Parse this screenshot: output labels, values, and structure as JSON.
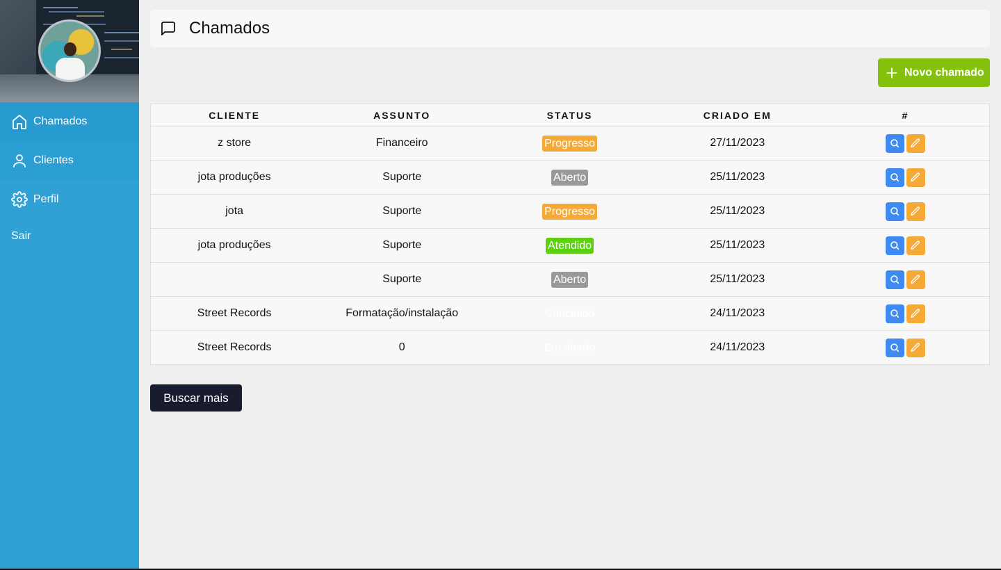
{
  "sidebar": {
    "items": [
      {
        "label": "Chamados",
        "icon": "home-icon"
      },
      {
        "label": "Clientes",
        "icon": "user-icon"
      },
      {
        "label": "Perfil",
        "icon": "gear-icon"
      }
    ],
    "logout_label": "Sair"
  },
  "header": {
    "title": "Chamados",
    "icon": "message-square-icon"
  },
  "new_button": {
    "label": "Novo chamado",
    "icon": "plus-icon",
    "color": "#83c10d"
  },
  "table": {
    "columns": [
      "CLIENTE",
      "ASSUNTO",
      "STATUS",
      "CRIADO EM",
      "#"
    ],
    "rows": [
      {
        "cliente": "z store",
        "assunto": "Financeiro",
        "status": "Progresso",
        "status_color": "#f5a936",
        "criado": "27/11/2023"
      },
      {
        "cliente": "jota produções",
        "assunto": "Suporte",
        "status": "Aberto",
        "status_color": "#999999",
        "criado": "25/11/2023"
      },
      {
        "cliente": "jota",
        "assunto": "Suporte",
        "status": "Progresso",
        "status_color": "#f5a936",
        "criado": "25/11/2023"
      },
      {
        "cliente": "jota produções",
        "assunto": "Suporte",
        "status": "Atendido",
        "status_color": "#5ccf0f",
        "criado": "25/11/2023"
      },
      {
        "cliente": "",
        "assunto": "Suporte",
        "status": "Aberto",
        "status_color": "#999999",
        "criado": "25/11/2023"
      },
      {
        "cliente": "Street Records",
        "assunto": "Formatação/instalação",
        "status": "Concluido",
        "status_color": "transparent",
        "criado": "24/11/2023"
      },
      {
        "cliente": "Street Records",
        "assunto": "0",
        "status": "Em aberto",
        "status_color": "transparent",
        "criado": "24/11/2023"
      }
    ],
    "action_icons": {
      "view": "search-icon",
      "edit": "pencil-icon"
    },
    "action_colors": {
      "view": "#3e8af2",
      "edit": "#f5a936"
    }
  },
  "more_button": {
    "label": "Buscar mais"
  }
}
